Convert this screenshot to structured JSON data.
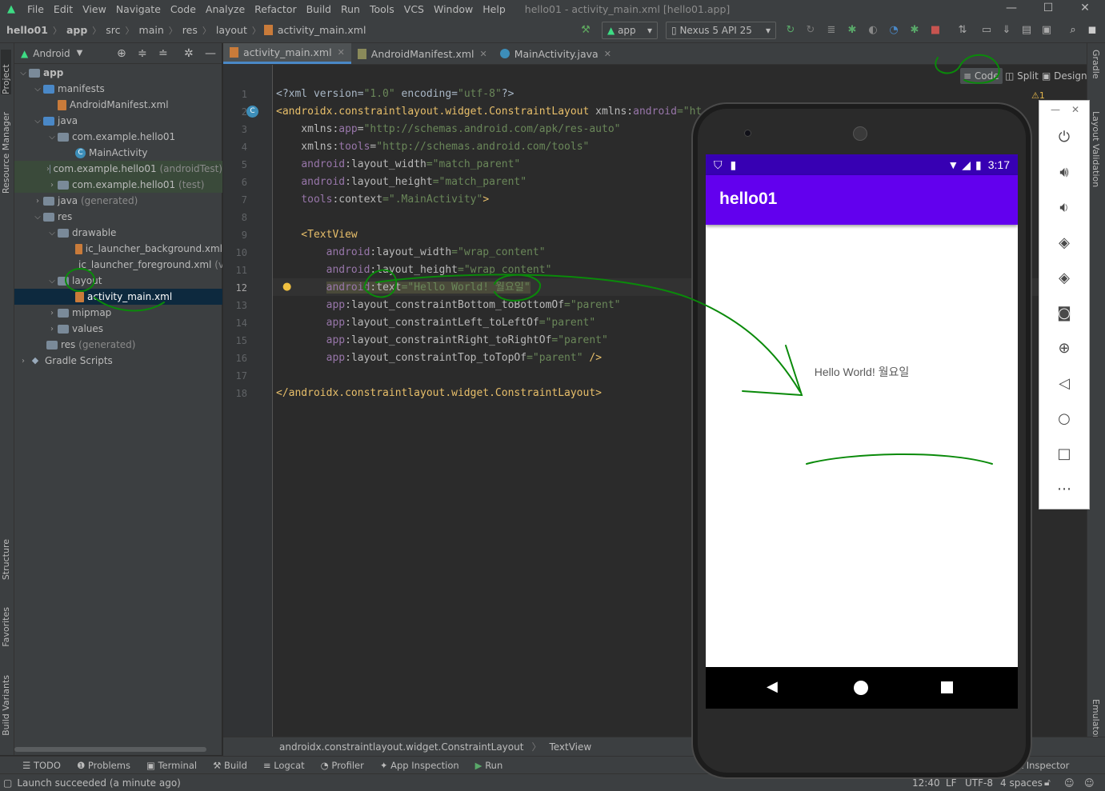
{
  "menubar": {
    "items": [
      "File",
      "Edit",
      "View",
      "Navigate",
      "Code",
      "Analyze",
      "Refactor",
      "Build",
      "Run",
      "Tools",
      "VCS",
      "Window",
      "Help"
    ],
    "window_title": "hello01 - activity_main.xml [hello01.app]"
  },
  "navbar": {
    "crumbs": [
      "hello01",
      "app",
      "src",
      "main",
      "res",
      "layout",
      "activity_main.xml"
    ],
    "run_config": "app",
    "device": "Nexus 5 API 25"
  },
  "project_panel": {
    "view_mode": "Android",
    "tree": [
      {
        "label": "app"
      },
      {
        "label": "manifests"
      },
      {
        "label": "AndroidManifest.xml"
      },
      {
        "label": "java"
      },
      {
        "label": "com.example.hello01"
      },
      {
        "label": "MainActivity"
      },
      {
        "label": "com.example.hello01",
        "suffix": "(androidTest)"
      },
      {
        "label": "com.example.hello01",
        "suffix": "(test)"
      },
      {
        "label": "java",
        "suffix": "(generated)"
      },
      {
        "label": "res"
      },
      {
        "label": "drawable"
      },
      {
        "label": "ic_launcher_background.xml"
      },
      {
        "label": "ic_launcher_foreground.xml",
        "suffix": "(v24)"
      },
      {
        "label": "layout"
      },
      {
        "label": "activity_main.xml"
      },
      {
        "label": "mipmap"
      },
      {
        "label": "values"
      },
      {
        "label": "res",
        "suffix": "(generated)"
      },
      {
        "label": "Gradle Scripts"
      }
    ]
  },
  "left_stripe": {
    "project": "Project",
    "resource_manager": "Resource Manager",
    "structure": "Structure",
    "favorites": "Favorites",
    "build_variants": "Build Variants"
  },
  "right_stripe": {
    "gradle": "Gradle",
    "layout_validation": "Layout Validation",
    "emulator": "Emulator"
  },
  "tabs": [
    {
      "label": "activity_main.xml"
    },
    {
      "label": "AndroidManifest.xml"
    },
    {
      "label": "MainActivity.java"
    }
  ],
  "view_modes": {
    "code": "Code",
    "split": "Split",
    "design": "Design"
  },
  "warnings": "1",
  "editor": {
    "line_numbers": [
      "1",
      "2",
      "3",
      "4",
      "5",
      "6",
      "7",
      "8",
      "9",
      "10",
      "11",
      "12",
      "13",
      "14",
      "15",
      "16",
      "17",
      "18"
    ],
    "current_line": "12",
    "lines": {
      "l1": {
        "a": "<?xml version=",
        "b": "\"1.0\"",
        "c": " encoding=",
        "d": "\"utf-8\"",
        "e": "?>"
      },
      "l2": {
        "a": "<androidx.constraintlayout.widget.ConstraintLayout ",
        "b": "xmlns:",
        "c": "android",
        "d": "=\"ht"
      },
      "l3": {
        "a": "    xmlns:",
        "b": "app",
        "c": "=",
        "d": "\"http://schemas.android.com/apk/res-auto\""
      },
      "l4": {
        "a": "    xmlns:",
        "b": "tools",
        "c": "=",
        "d": "\"http://schemas.android.com/tools\""
      },
      "l5": {
        "a": "    ",
        "b": "android",
        ":": ":",
        "c": "layout_width",
        "d": "=\"match_parent\""
      },
      "l6": {
        "a": "    ",
        "b": "android",
        ":": ":",
        "c": "layout_height",
        "d": "=\"match_parent\""
      },
      "l7": {
        "a": "    ",
        "b": "tools",
        ":": ":",
        "c": "context",
        "d": "=\".MainActivity\"",
        "e": ">"
      },
      "l9": {
        "a": "    <TextView"
      },
      "l10": {
        "a": "        ",
        "b": "android",
        ":": ":",
        "c": "layout_width",
        "d": "=\"wrap_content\""
      },
      "l11": {
        "a": "        ",
        "b": "android",
        ":": ":",
        "c": "layout_height",
        "d": "=\"wrap_content\""
      },
      "l12": {
        "a": "        ",
        "b": "android",
        ":": ":",
        "c": "text",
        "d": "=\"Hello World! 월요일\""
      },
      "l13": {
        "a": "        ",
        "b": "app",
        ":": ":",
        "c": "layout_constraintBottom_toBottomOf",
        "d": "=\"parent\""
      },
      "l14": {
        "a": "        ",
        "b": "app",
        ":": ":",
        "c": "layout_constraintLeft_toLeftOf",
        "d": "=\"parent\""
      },
      "l15": {
        "a": "        ",
        "b": "app",
        ":": ":",
        "c": "layout_constraintRight_toRightOf",
        "d": "=\"parent\""
      },
      "l16": {
        "a": "        ",
        "b": "app",
        ":": ":",
        "c": "layout_constraintTop_toTopOf",
        "d": "=\"parent\"",
        "e": " />"
      },
      "l18": {
        "a": "</androidx.constraintlayout.widget.ConstraintLayout>"
      }
    }
  },
  "breadcrumb": [
    "androidx.constraintlayout.widget.ConstraintLayout",
    "TextView"
  ],
  "toolwindows": [
    "TODO",
    "Problems",
    "Terminal",
    "Build",
    "Logcat",
    "Profiler",
    "App Inspection",
    "Run"
  ],
  "layout_inspector": "Layout Inspector",
  "status": {
    "message": "Launch succeeded (a minute ago)",
    "position": "12:40",
    "line_sep": "LF",
    "encoding": "UTF-8",
    "indent": "4 spaces"
  },
  "emulator": {
    "time": "3:17",
    "app_title": "hello01",
    "hello_text": "Hello World! 월요일"
  },
  "colors": {
    "status_bar": "#3700b3",
    "app_bar": "#6200ee",
    "annotation_ink": "#0a8a0a"
  }
}
